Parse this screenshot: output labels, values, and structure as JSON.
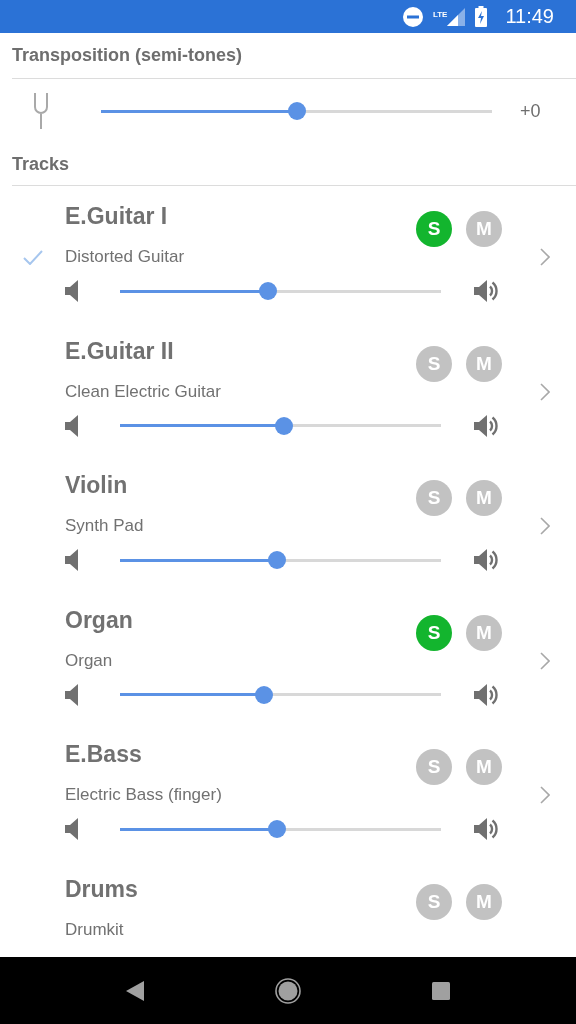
{
  "status_bar": {
    "network_type": "LTE",
    "time": "11:49"
  },
  "transposition": {
    "title": "Transposition (semi-tones)",
    "level": 0.5,
    "reading": "+0"
  },
  "tracks_section": {
    "title": "Tracks"
  },
  "tracks": [
    {
      "name": "E.Guitar I",
      "instrument": "Distorted Guitar",
      "selected": true,
      "solo_label": "S",
      "solo": true,
      "mute_label": "M",
      "mute": false,
      "details": true,
      "level": 0.46
    },
    {
      "name": "E.Guitar II",
      "instrument": "Clean Electric Guitar",
      "selected": false,
      "solo_label": "S",
      "solo": false,
      "mute_label": "M",
      "mute": false,
      "details": true,
      "level": 0.51
    },
    {
      "name": "Violin",
      "instrument": "Synth Pad",
      "selected": false,
      "solo_label": "S",
      "solo": false,
      "mute_label": "M",
      "mute": false,
      "details": true,
      "level": 0.49
    },
    {
      "name": "Organ",
      "instrument": "Organ",
      "selected": false,
      "solo_label": "S",
      "solo": true,
      "mute_label": "M",
      "mute": false,
      "details": true,
      "level": 0.45
    },
    {
      "name": "E.Bass",
      "instrument": "Electric Bass (finger)",
      "selected": false,
      "solo_label": "S",
      "solo": false,
      "mute_label": "M",
      "mute": false,
      "details": true,
      "level": 0.49
    },
    {
      "name": "Drums",
      "instrument": "Drumkit",
      "selected": false,
      "solo_label": "S",
      "solo": false,
      "mute_label": "M",
      "mute": false,
      "details": false
    }
  ]
}
